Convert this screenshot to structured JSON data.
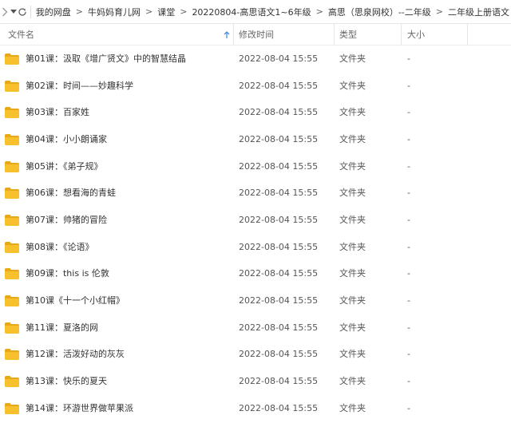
{
  "breadcrumb": {
    "items": [
      "我的网盘",
      "牛妈妈育儿网",
      "课堂",
      "20220804-高思语文1~6年级",
      "高思（思泉网校）--二年级",
      "二年级上册语文"
    ]
  },
  "header": {
    "name": "文件名",
    "modified": "修改时间",
    "type": "类型",
    "size": "大小"
  },
  "colors": {
    "folder": "#f7c12d",
    "folder_tab": "#e9a81a",
    "sort_arrow": "#4a8ee8"
  },
  "rows": [
    {
      "name": "第01课：汲取《增广贤文》中的智慧结晶",
      "modified": "2022-08-04 15:55",
      "type": "文件夹",
      "size": "-"
    },
    {
      "name": "第02课：时间——妙趣科学",
      "modified": "2022-08-04 15:55",
      "type": "文件夹",
      "size": "-"
    },
    {
      "name": "第03课：百家姓",
      "modified": "2022-08-04 15:55",
      "type": "文件夹",
      "size": "-"
    },
    {
      "name": "第04课：小小朗诵家",
      "modified": "2022-08-04 15:55",
      "type": "文件夹",
      "size": "-"
    },
    {
      "name": "第05讲：《弟子规》",
      "modified": "2022-08-04 15:55",
      "type": "文件夹",
      "size": "-"
    },
    {
      "name": "第06课：想看海的青蛙",
      "modified": "2022-08-04 15:55",
      "type": "文件夹",
      "size": "-"
    },
    {
      "name": "第07课：帅猪的冒险",
      "modified": "2022-08-04 15:55",
      "type": "文件夹",
      "size": "-"
    },
    {
      "name": "第08课：《论语》",
      "modified": "2022-08-04 15:55",
      "type": "文件夹",
      "size": "-"
    },
    {
      "name": "第09课：this is 伦敦",
      "modified": "2022-08-04 15:55",
      "type": "文件夹",
      "size": "-"
    },
    {
      "name": "第10课《十一个小红帽》",
      "modified": "2022-08-04 15:55",
      "type": "文件夹",
      "size": "-"
    },
    {
      "name": "第11课：夏洛的网",
      "modified": "2022-08-04 15:55",
      "type": "文件夹",
      "size": "-"
    },
    {
      "name": "第12课：活泼好动的灰灰",
      "modified": "2022-08-04 15:55",
      "type": "文件夹",
      "size": "-"
    },
    {
      "name": "第13课：快乐的夏天",
      "modified": "2022-08-04 15:55",
      "type": "文件夹",
      "size": "-"
    },
    {
      "name": "第14课：环游世界做苹果派",
      "modified": "2022-08-04 15:55",
      "type": "文件夹",
      "size": "-"
    }
  ]
}
